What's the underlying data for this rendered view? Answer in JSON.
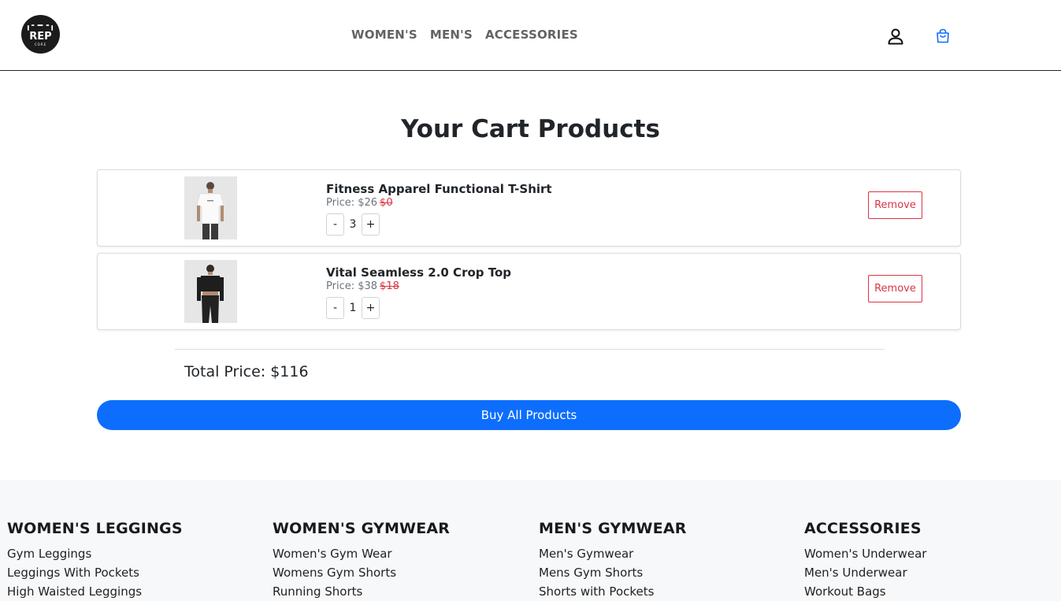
{
  "brand": {
    "logo_mark": "╻╸━╺╻",
    "logo_text": "REP",
    "logo_sub": "CORE"
  },
  "nav": [
    {
      "label": "WOMEN'S"
    },
    {
      "label": "MEN'S"
    },
    {
      "label": "ACCESSORIES"
    }
  ],
  "icons": {
    "account": "user-icon",
    "cart": "shopping-bag-icon"
  },
  "colors": {
    "primary": "#0d6efd",
    "danger": "#dc3545",
    "muted": "#6c757d",
    "footer_bg": "#f7f8f9"
  },
  "cart": {
    "title": "Your Cart Products",
    "items": [
      {
        "name": "Fitness Apparel Functional T-Shirt",
        "price_label": "Price: $26",
        "original_price": "$0",
        "qty": "3",
        "minus": "-",
        "plus": "+",
        "remove_label": "Remove"
      },
      {
        "name": "Vital Seamless 2.0 Crop Top",
        "price_label": "Price: $38",
        "original_price": "$18",
        "qty": "1",
        "minus": "-",
        "plus": "+",
        "remove_label": "Remove"
      }
    ],
    "total_label": "Total Price: $116",
    "buy_label": "Buy All Products"
  },
  "footer": [
    {
      "heading": "WOMEN'S LEGGINGS",
      "links": [
        "Gym Leggings",
        "Leggings With Pockets",
        "High Waisted Leggings"
      ]
    },
    {
      "heading": "WOMEN'S GYMWEAR",
      "links": [
        "Women's Gym Wear",
        "Womens Gym Shorts",
        "Running Shorts"
      ]
    },
    {
      "heading": "MEN'S GYMWEAR",
      "links": [
        "Men's Gymwear",
        "Mens Gym Shorts",
        "Shorts with Pockets"
      ]
    },
    {
      "heading": "ACCESSORIES",
      "links": [
        "Women's Underwear",
        "Men's Underwear",
        "Workout Bags"
      ]
    }
  ]
}
